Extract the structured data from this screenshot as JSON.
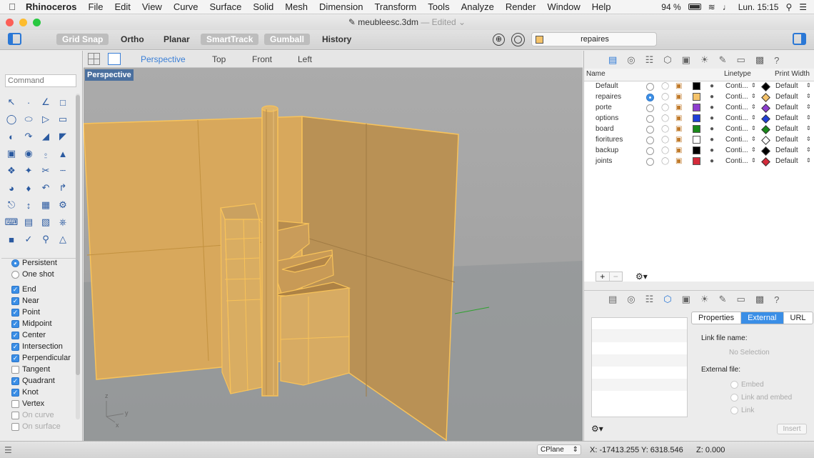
{
  "menubar": {
    "app": "Rhinoceros",
    "items": [
      "File",
      "Edit",
      "View",
      "Curve",
      "Surface",
      "Solid",
      "Mesh",
      "Dimension",
      "Transform",
      "Tools",
      "Analyze",
      "Render",
      "Window",
      "Help"
    ],
    "battery": "94 %",
    "clock": "Lun. 15:15"
  },
  "window": {
    "title": "meubleesc.3dm",
    "edited": "— Edited"
  },
  "toolbar": {
    "grid_snap": "Grid Snap",
    "ortho": "Ortho",
    "planar": "Planar",
    "smarttrack": "SmartTrack",
    "gumball": "Gumball",
    "history": "History",
    "current_layer": "repaires",
    "current_layer_color": "#f5c36a"
  },
  "command": {
    "placeholder": "Command"
  },
  "osnap": {
    "persistent": "Persistent",
    "one_shot": "One shot",
    "items": [
      {
        "label": "End",
        "checked": true
      },
      {
        "label": "Near",
        "checked": true
      },
      {
        "label": "Point",
        "checked": true
      },
      {
        "label": "Midpoint",
        "checked": true
      },
      {
        "label": "Center",
        "checked": true
      },
      {
        "label": "Intersection",
        "checked": true
      },
      {
        "label": "Perpendicular",
        "checked": true
      },
      {
        "label": "Tangent",
        "checked": false
      },
      {
        "label": "Quadrant",
        "checked": true
      },
      {
        "label": "Knot",
        "checked": true
      },
      {
        "label": "Vertex",
        "checked": false
      },
      {
        "label": "On curve",
        "checked": false,
        "disabled": true
      },
      {
        "label": "On surface",
        "checked": false,
        "disabled": true
      }
    ]
  },
  "viewport": {
    "tabs": [
      "Perspective",
      "Top",
      "Front",
      "Left"
    ],
    "active_tab": "Perspective",
    "label": "Perspective",
    "axes": {
      "z": "z",
      "y": "y",
      "x": "x"
    }
  },
  "layers": {
    "headers": {
      "name": "Name",
      "linetype": "Linetype",
      "print_width": "Print Width"
    },
    "rows": [
      {
        "name": "Default",
        "color": "#000000",
        "print_color": "#000000",
        "linetype": "Conti...",
        "width": "Default",
        "current": false
      },
      {
        "name": "repaires",
        "color": "#f5c36a",
        "print_color": "#f5c36a",
        "linetype": "Conti...",
        "width": "Default",
        "current": true
      },
      {
        "name": "porte",
        "color": "#8e3fd0",
        "print_color": "#8e3fd0",
        "linetype": "Conti...",
        "width": "Default",
        "current": false
      },
      {
        "name": "options",
        "color": "#1f3fd8",
        "print_color": "#1f3fd8",
        "linetype": "Conti...",
        "width": "Default",
        "current": false
      },
      {
        "name": "board",
        "color": "#1a8a1a",
        "print_color": "#1a8a1a",
        "linetype": "Conti...",
        "width": "Default",
        "current": false
      },
      {
        "name": "fioritures",
        "color": "#ffffff",
        "print_color": "#ffffff",
        "linetype": "Conti...",
        "width": "Default",
        "current": false
      },
      {
        "name": "backup",
        "color": "#000000",
        "print_color": "#000000",
        "linetype": "Conti...",
        "width": "Default",
        "current": false
      },
      {
        "name": "joints",
        "color": "#d42a3a",
        "print_color": "#d42a3a",
        "linetype": "Conti...",
        "width": "Default",
        "current": false
      }
    ]
  },
  "properties": {
    "tabs": [
      "Properties",
      "External",
      "URL"
    ],
    "active_tab": "External",
    "link_file_label": "Link file name:",
    "no_selection": "No Selection",
    "external_file_label": "External file:",
    "options": [
      "Embed",
      "Link and embed",
      "Link"
    ],
    "insert": "Insert"
  },
  "status": {
    "cplane": "CPlane",
    "coords": "X: -17413.255 Y: 6318.546",
    "z": "Z: 0.000"
  }
}
